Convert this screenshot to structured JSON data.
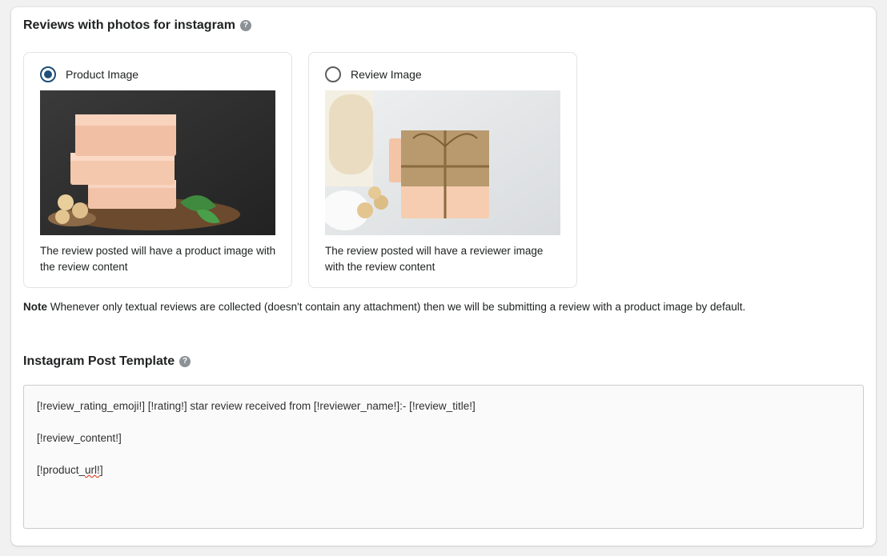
{
  "section1": {
    "title": "Reviews with photos for instagram",
    "help": "?"
  },
  "options": [
    {
      "label": "Product Image",
      "selected": true,
      "description": "The review posted will have a product image with the review content",
      "image": "soap-bars-stack-photo"
    },
    {
      "label": "Review Image",
      "selected": false,
      "description": "The review posted will have a reviewer image with the review content",
      "image": "wrapped-soap-gift-photo"
    }
  ],
  "note": {
    "label": "Note",
    "text": " Whenever only textual reviews are collected (doesn't contain any attachment) then we will be submitting a review with a product image by default."
  },
  "section2": {
    "title": "Instagram Post Template",
    "help": "?"
  },
  "template": {
    "line1": "[!review_rating_emoji!] [!rating!] star review received from [!reviewer_name!]:- [!review_title!]",
    "line2": "[!review_content!]",
    "line3_prefix": "[!product_",
    "line3_misspelled": "url!",
    "line3_suffix": "]"
  },
  "colors": {
    "radio_selected": "#1f4e79",
    "panel_bg": "#ffffff",
    "page_bg": "#f1f1f1"
  }
}
